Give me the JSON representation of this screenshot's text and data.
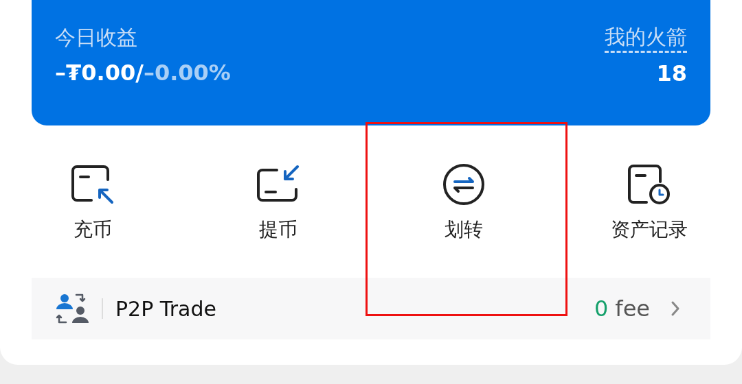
{
  "earnings_card": {
    "label": "今日收益",
    "amount": "–₮0.00/",
    "percent": "–0.00%",
    "rockets_label": "我的火箭",
    "rockets_count": "18"
  },
  "actions": [
    {
      "kind": "deposit",
      "label": "充币",
      "highlighted": false
    },
    {
      "kind": "withdraw",
      "label": "提币",
      "highlighted": false
    },
    {
      "kind": "transfer",
      "label": "划转",
      "highlighted": true
    },
    {
      "kind": "history",
      "label": "资产记录",
      "highlighted": false
    }
  ],
  "p2p": {
    "title": "P2P Trade",
    "fee_value": "0",
    "fee_label": "fee"
  }
}
